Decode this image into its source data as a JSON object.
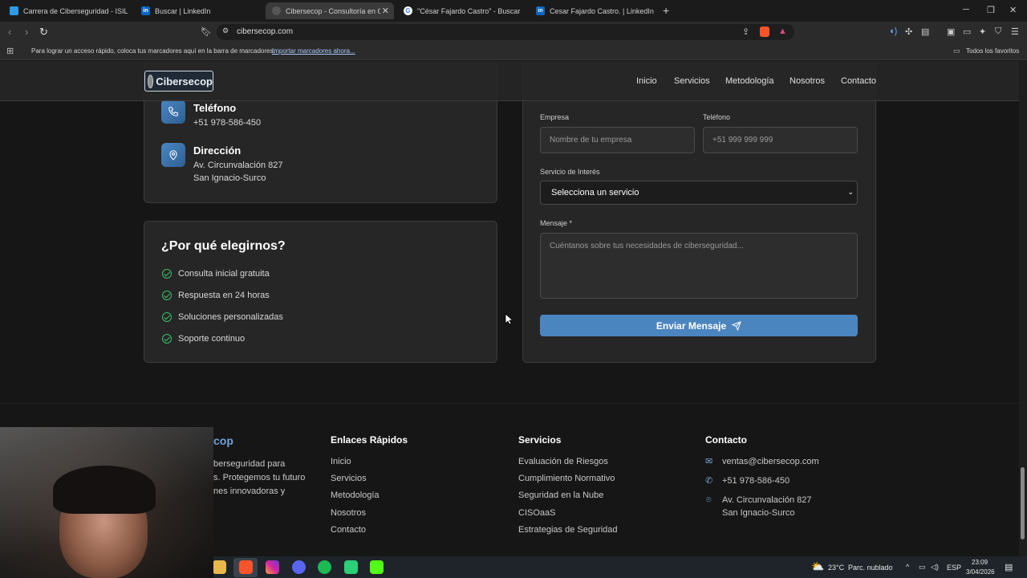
{
  "browser": {
    "tabs": [
      {
        "label": "Carrera de Ciberseguridad - ISIL"
      },
      {
        "label": "Buscar | LinkedIn"
      },
      {
        "label": "Cibersecop - Consultoría en Cibe"
      },
      {
        "label": "\"César Fajardo Castro\" - Buscar con G"
      },
      {
        "label": "Cesar Fajardo Castro. | LinkedIn"
      }
    ],
    "url": "cibersecop.com",
    "bookmarks_hint": "Para lograr un acceso rápido, coloca tus marcadores aquí en la barra de marcadores.",
    "bookmarks_import": "Importar marcadores ahora...",
    "all_favorites": "Todos los favoritos"
  },
  "header": {
    "logo": "Cibersecop",
    "nav": [
      "Inicio",
      "Servicios",
      "Metodología",
      "Nosotros",
      "Contacto"
    ]
  },
  "contact_info": {
    "phone_title": "Teléfono",
    "phone": "+51 978-586-450",
    "address_title": "Dirección",
    "address_line1": "Av. Circunvalación 827",
    "address_line2": "San Ignacio-Surco"
  },
  "why_us": {
    "title": "¿Por qué elegirnos?",
    "items": [
      "Consulta inicial gratuita",
      "Respuesta en 24 horas",
      "Soluciones personalizadas",
      "Soporte continuo"
    ]
  },
  "form": {
    "company_label": "Empresa",
    "company_placeholder": "Nombre de tu empresa",
    "phone_label": "Teléfono",
    "phone_placeholder": "+51 999 999 999",
    "service_label": "Servicio de Interés",
    "service_selected": "Selecciona un servicio",
    "message_label": "Mensaje *",
    "message_placeholder": "Cuéntanos sobre tus necesidades de ciberseguridad...",
    "submit": "Enviar Mensaje"
  },
  "footer": {
    "brand_partial": "cop",
    "brand_desc_lines": [
      "berseguridad para",
      "s. Protegemos tu futuro",
      "nes innovadoras y"
    ],
    "quick_links_title": "Enlaces Rápidos",
    "quick_links": [
      "Inicio",
      "Servicios",
      "Metodología",
      "Nosotros",
      "Contacto"
    ],
    "services_title": "Servicios",
    "services": [
      "Evaluación de Riesgos",
      "Cumplimiento Normativo",
      "Seguridad en la Nube",
      "CISOaaS",
      "Estrategias de Seguridad"
    ],
    "contact_title": "Contacto",
    "email": "ventas@cibersecop.com",
    "phone": "+51 978-586-450",
    "address_line1": "Av. Circunvalación 827",
    "address_line2": "San Ignacio-Surco"
  },
  "taskbar": {
    "weather": "23°C",
    "weather_desc": "Parc. nublado",
    "lang": "ESP",
    "time": "23:09",
    "date": "3/04/2026"
  }
}
